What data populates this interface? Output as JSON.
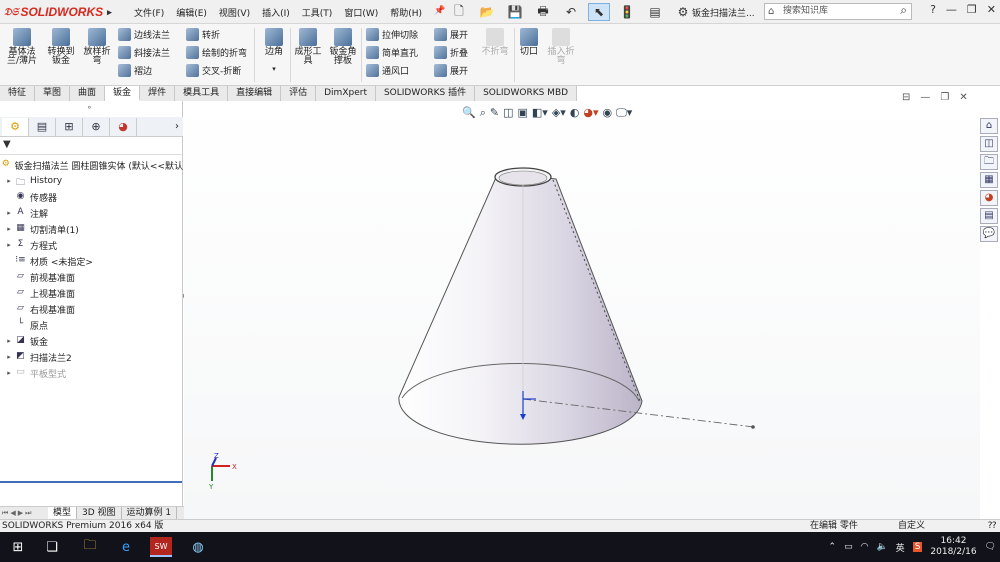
{
  "app": {
    "logo_text": "SOLIDWORKS",
    "doc_title": "钣金扫描法兰..."
  },
  "menus": [
    "文件(F)",
    "编辑(E)",
    "视图(V)",
    "插入(I)",
    "工具(T)",
    "窗口(W)",
    "帮助(H)"
  ],
  "search": {
    "placeholder": "搜索知识库"
  },
  "ribbon": {
    "big": [
      {
        "label": "基体法兰/薄片"
      },
      {
        "label": "转换到钣金"
      },
      {
        "label": "放样折弯"
      }
    ],
    "col1": [
      "边线法兰",
      "斜接法兰",
      "褶边"
    ],
    "col2": [
      "转折",
      "绘制的折弯",
      "交叉-折断"
    ],
    "corner": "边角",
    "forming": "成形工具",
    "gusset": "钣金角撑板",
    "col3": [
      "拉伸切除",
      "简单直孔",
      "通风口"
    ],
    "col4": [
      "展开",
      "折叠",
      "展开"
    ],
    "no_bend": "不折弯",
    "rip": "切口",
    "insert_bends": "插入折弯"
  },
  "tabs": [
    "特征",
    "草图",
    "曲面",
    "钣金",
    "焊件",
    "模具工具",
    "直接编辑",
    "评估",
    "DimXpert",
    "SOLIDWORKS 插件",
    "SOLIDWORKS MBD"
  ],
  "active_tab": "钣金",
  "tree": {
    "root": "钣金扫描法兰 圆柱圆锥实体 (默认<<默认",
    "items": [
      {
        "label": "History",
        "expand": "▸"
      },
      {
        "label": "传感器",
        "expand": ""
      },
      {
        "label": "注解",
        "expand": "▸"
      },
      {
        "label": "切割清单(1)",
        "expand": "▸"
      },
      {
        "label": "方程式",
        "expand": "▸"
      },
      {
        "label": "材质 <未指定>",
        "expand": ""
      },
      {
        "label": "前视基准面",
        "expand": ""
      },
      {
        "label": "上视基准面",
        "expand": ""
      },
      {
        "label": "右视基准面",
        "expand": ""
      },
      {
        "label": "原点",
        "expand": ""
      },
      {
        "label": "钣金",
        "expand": "▸"
      },
      {
        "label": "扫描法兰2",
        "expand": "▸"
      },
      {
        "label": "平板型式",
        "expand": "▸"
      }
    ]
  },
  "bottom_tabs": [
    "模型",
    "3D 视图",
    "运动算例 1"
  ],
  "status": {
    "left": "SOLIDWORKS Premium 2016 x64 版",
    "right1": "在编辑 零件",
    "right2": "自定义"
  },
  "triad": {
    "x": "X",
    "y": "Y",
    "z": "Z"
  },
  "clock": {
    "time": "16:42",
    "date": "2018/2/16"
  },
  "tray": {
    "ime": "英"
  }
}
